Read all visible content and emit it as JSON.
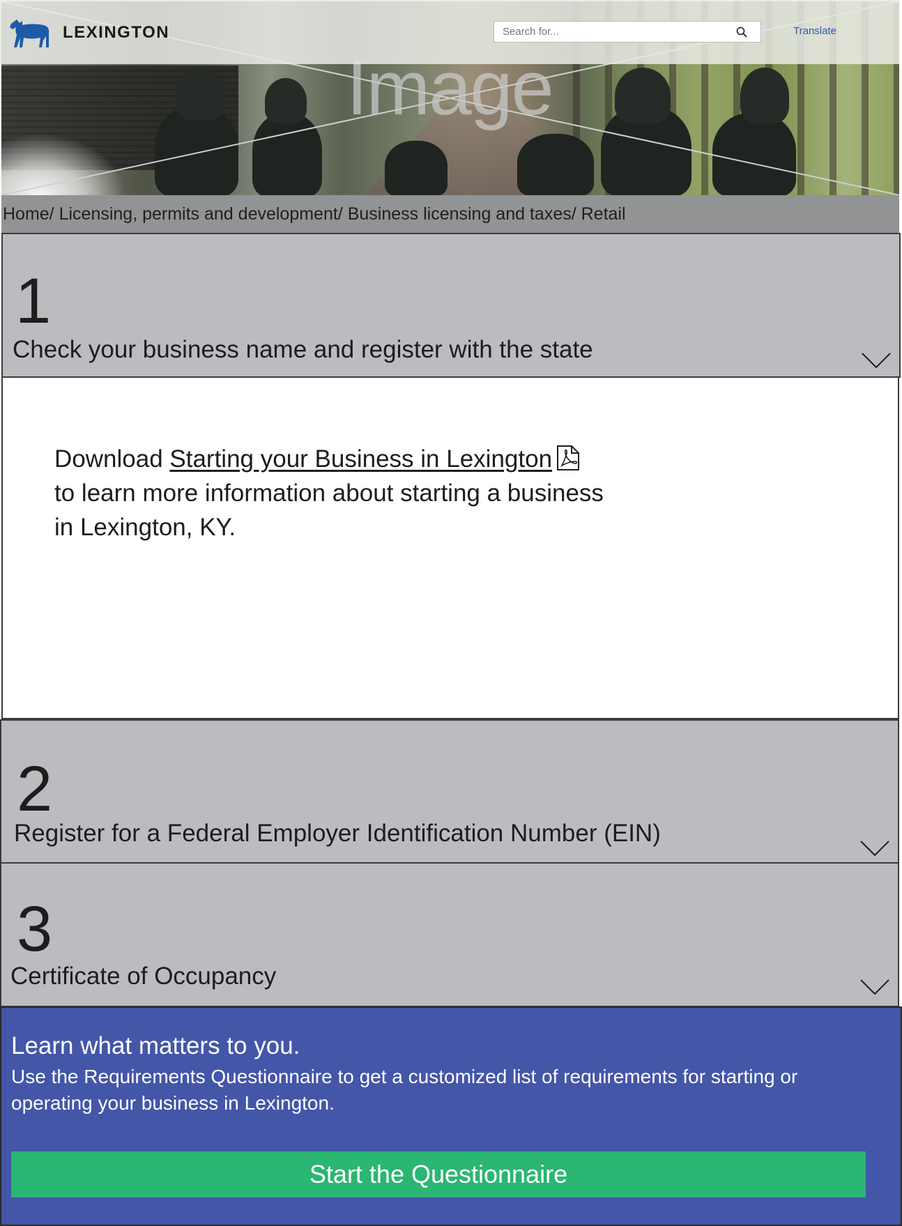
{
  "header": {
    "logo_text": "LEXINGTON",
    "search_placeholder": "Search for...",
    "translate_label": "Translate"
  },
  "hero": {
    "placeholder_word": "Image"
  },
  "breadcrumb": {
    "text": "Home/ Licensing, permits and development/ Business licensing and taxes/ Retail"
  },
  "steps": [
    {
      "number": "1",
      "title": "Check your business name and register with the state",
      "expanded": true,
      "body": {
        "prefix": "Download ",
        "link_text": "Starting your Business in Lexington",
        "suffix": "to learn more information about starting a business in Lexington, KY."
      }
    },
    {
      "number": "2",
      "title": "Register for a Federal Employer Identification Number (EIN)",
      "expanded": false
    },
    {
      "number": "3",
      "title": "Certificate of Occupancy",
      "expanded": false
    }
  ],
  "cta": {
    "heading": "Learn what matters to you.",
    "description": "Use the Requirements Questionnaire to get a customized list of requirements for starting or operating your business in Lexington.",
    "button_label": "Start the Questionnaire"
  },
  "colors": {
    "accordion_header": "#bbbcc0",
    "breadcrumb_bg": "#929394",
    "cta_bg": "#4356a8",
    "cta_button": "#2bb673",
    "translate_link": "#2f54b5",
    "logo_horse": "#1d5aa8"
  },
  "icons": [
    "horse-logo-icon",
    "search-icon",
    "chevron-down-icon",
    "pdf-icon"
  ]
}
